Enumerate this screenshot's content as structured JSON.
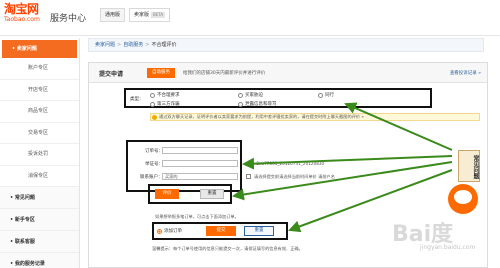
{
  "header": {
    "logo_main": "淘宝网",
    "logo_sub": "Taobao.com",
    "service_title": "服务中心",
    "tabs": [
      {
        "label": "通用版",
        "tag": ""
      },
      {
        "label": "卖家版",
        "tag": "BETA"
      }
    ]
  },
  "sidebar": {
    "top": "• 卖家问题",
    "items": [
      "账户专区",
      "开店专区",
      "商品专区",
      "交易专区",
      "投诉处罚",
      "消保专区"
    ],
    "sections": [
      "• 常见问题",
      "• 新手专区",
      "• 联系客服",
      "• 我的服务记录"
    ]
  },
  "breadcrumb": {
    "items": [
      "卖家问题",
      "自助服务",
      "不合理评价"
    ]
  },
  "panel": {
    "title": "提交申请",
    "tab_button": "自助服务",
    "tab_hint": "给我们的店铺30天内最新评价并进行评价",
    "view_history": "查看投诉记录 »"
  },
  "type_select": {
    "label": "类型：",
    "options": [
      "不合理要求",
      "买家胁迫",
      "同行",
      "第三方诈骗",
      "泄露信息和辱骂"
    ],
    "selected_index": -1
  },
  "notice": "通过双方聊天记录，证明评价者以卖家要求为前提，利用中差评骚扰卖家的，请在提交时附上聊天截图的评价 »",
  "form": {
    "order_label": "订单号：",
    "order_value": "",
    "evidence_label": "举证号：",
    "evidence_value": "",
    "evidence_hint": "例：2xa77831_20120731_20120830",
    "contact_label": "联系账户：",
    "contact_value": "买家的",
    "check_hint": "请选择提交前请选择当前时间单价 请前户名"
  },
  "buttons": {
    "submit": "评价",
    "reset": "重置"
  },
  "help_text": "如果想举报多笔订单，可点击下面添加订单。",
  "add_order": {
    "option_label": "添加订单",
    "select_button": "提交",
    "add_button": "重置"
  },
  "bottom_tip": "温馨提示：每个订单号使用的信息只能提交一次，请保证填写的信息有效、正确。",
  "mascot": {
    "scroll_text": "常见问题"
  },
  "watermark": {
    "text": "Bai度",
    "sub": "jingyan.baidu.com"
  },
  "colors": {
    "brand": "#ff4400",
    "accent": "#ff6a00",
    "link": "#2a5f9e",
    "arrow": "#3a8a1c"
  }
}
